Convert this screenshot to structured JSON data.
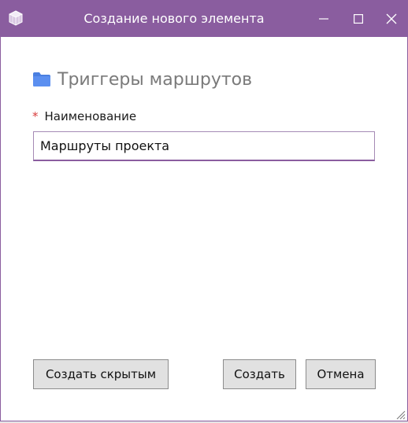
{
  "window": {
    "title": "Создание нового элемента"
  },
  "form": {
    "heading": "Триггеры маршрутов",
    "required_mark": "*",
    "name_label": "Наименование",
    "name_value": "Маршруты проекта"
  },
  "buttons": {
    "create_hidden": "Создать скрытым",
    "create": "Создать",
    "cancel": "Отмена"
  },
  "icons": {
    "app": "cube-app-icon",
    "heading": "folder-icon",
    "minimize": "minimize-icon",
    "maximize": "maximize-icon",
    "close": "close-icon",
    "resize": "resize-grip-icon"
  },
  "colors": {
    "titlebar": "#8a5d9f",
    "folder": "#4a7fe0",
    "required": "#d83b3b"
  }
}
